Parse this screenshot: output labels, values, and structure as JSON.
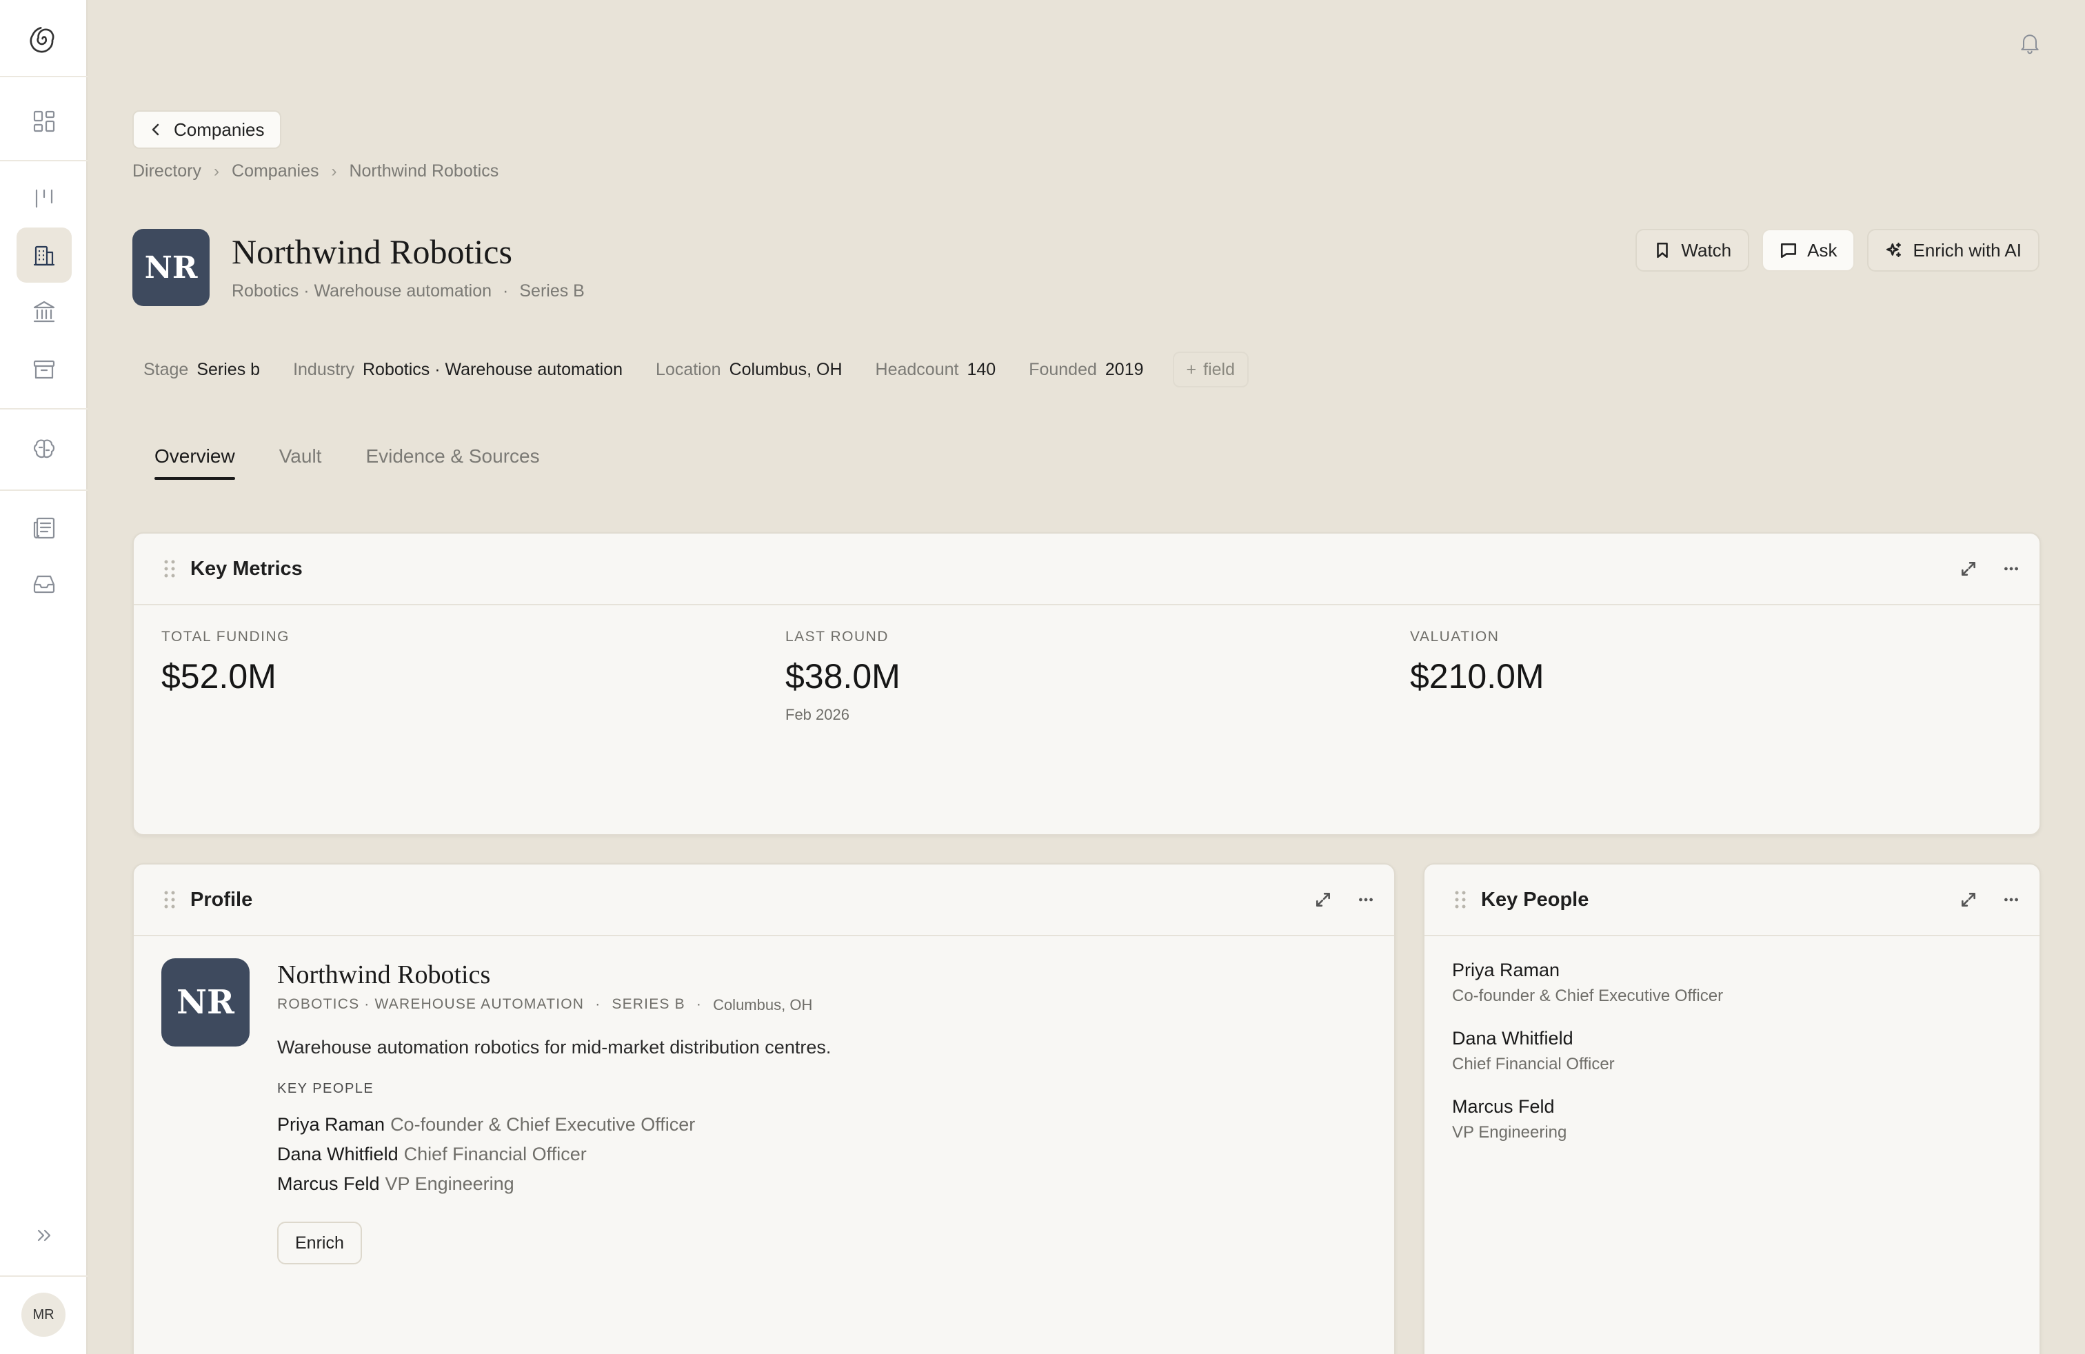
{
  "header": {
    "back_label": "Companies",
    "breadcrumb": [
      "Directory",
      "Companies",
      "Northwind Robotics"
    ]
  },
  "company": {
    "logo_initials": "NR",
    "name": "Northwind Robotics",
    "industry": "Robotics · Warehouse automation",
    "stage": "Series B"
  },
  "actions": {
    "watch": "Watch",
    "ask": "Ask",
    "enrich_ai": "Enrich with AI"
  },
  "fields": [
    {
      "key": "Stage",
      "value": "Series b"
    },
    {
      "key": "Industry",
      "value": "Robotics · Warehouse automation"
    },
    {
      "key": "Location",
      "value": "Columbus, OH"
    },
    {
      "key": "Headcount",
      "value": "140"
    },
    {
      "key": "Founded",
      "value": "2019"
    }
  ],
  "add_field_label": "field",
  "tabs": [
    "Overview",
    "Vault",
    "Evidence & Sources"
  ],
  "key_metrics": {
    "title": "Key Metrics",
    "items": [
      {
        "label": "TOTAL FUNDING",
        "value": "$52.0M",
        "note": ""
      },
      {
        "label": "LAST ROUND",
        "value": "$38.0M",
        "note": "Feb 2026"
      },
      {
        "label": "VALUATION",
        "value": "$210.0M",
        "note": ""
      }
    ]
  },
  "profile": {
    "title": "Profile",
    "name": "Northwind Robotics",
    "industry_caps": "ROBOTICS · WAREHOUSE AUTOMATION",
    "stage_caps": "SERIES B",
    "location": "Columbus, OH",
    "description": "Warehouse automation robotics for mid-market distribution centres.",
    "key_people_label": "KEY PEOPLE",
    "enrich_label": "Enrich"
  },
  "people": [
    {
      "name": "Priya Raman",
      "role": "Co-founder & Chief Executive Officer"
    },
    {
      "name": "Dana Whitfield",
      "role": "Chief Financial Officer"
    },
    {
      "name": "Marcus Feld",
      "role": "VP Engineering"
    }
  ],
  "key_people_card": {
    "title": "Key People"
  },
  "user": {
    "initials": "MR"
  },
  "separator": "·"
}
